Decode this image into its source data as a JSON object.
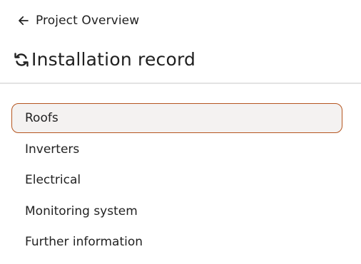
{
  "header": {
    "back_label": "Project Overview",
    "back_icon": "arrow-left-icon",
    "title": "Installation record",
    "title_icon": "sync-icon"
  },
  "nav": {
    "active_index": 0,
    "accent_color": "#b5551f",
    "items": [
      {
        "label": "Roofs"
      },
      {
        "label": "Inverters"
      },
      {
        "label": "Electrical"
      },
      {
        "label": "Monitoring system"
      },
      {
        "label": "Further information"
      }
    ]
  }
}
